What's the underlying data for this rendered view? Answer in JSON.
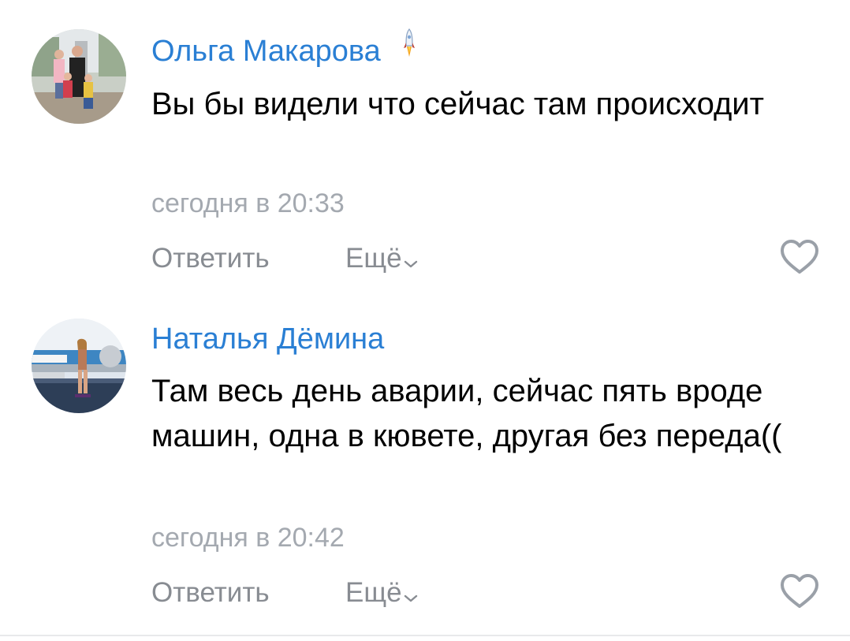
{
  "comments": [
    {
      "author": "Ольга Макарова",
      "badge_icon": "rocket-icon",
      "text": "Вы бы видели что сейчас там происходит",
      "time": "сегодня в 20:33",
      "reply_label": "Ответить",
      "more_label": "Ещё",
      "like_icon": "heart-icon"
    },
    {
      "author": "Наталья Дёмина",
      "text": "Там весь день аварии, сейчас пять вроде машин, одна в кювете, другая без переда((",
      "time": "сегодня в 20:42",
      "reply_label": "Ответить",
      "more_label": "Ещё",
      "like_icon": "heart-icon"
    }
  ],
  "colors": {
    "author": "#2a7fd4",
    "text": "#000000",
    "meta": "#a4a9b0",
    "action": "#888c92",
    "divider": "#e8e9eb"
  }
}
